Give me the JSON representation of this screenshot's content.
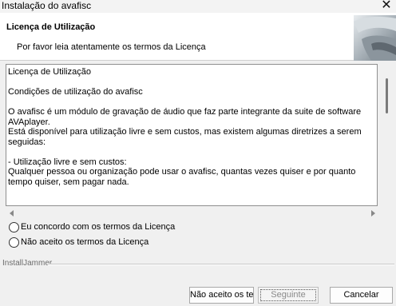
{
  "window": {
    "title": "Instalação do avafisc",
    "close_icon": "close-icon"
  },
  "header": {
    "title": "Licença de Utilização",
    "subtitle": "Por favor leia atentamente os termos da Licença"
  },
  "license": {
    "text": "Licença de Utilização\n\nCondições de utilização do avafisc\n\nO avafisc é um módulo de gravação de áudio que faz parte integrante da suite de software AVAplayer.\nEstá disponível para utilização livre e sem custos, mas existem algumas diretrizes a serem seguidas:\n\n- Utilização livre e sem custos:\nQualquer pessoa ou organização pode usar o avafisc, quantas vezes quiser e por quanto tempo quiser, sem pagar nada."
  },
  "options": {
    "accept_label": "Eu concordo com os termos da Licença",
    "decline_label": "Não aceito os termos da Licença"
  },
  "footer": {
    "installer": "InstallJammer"
  },
  "buttons": {
    "decline": "Não aceito os te",
    "next": "Seguinte",
    "cancel": "Cancelar"
  }
}
